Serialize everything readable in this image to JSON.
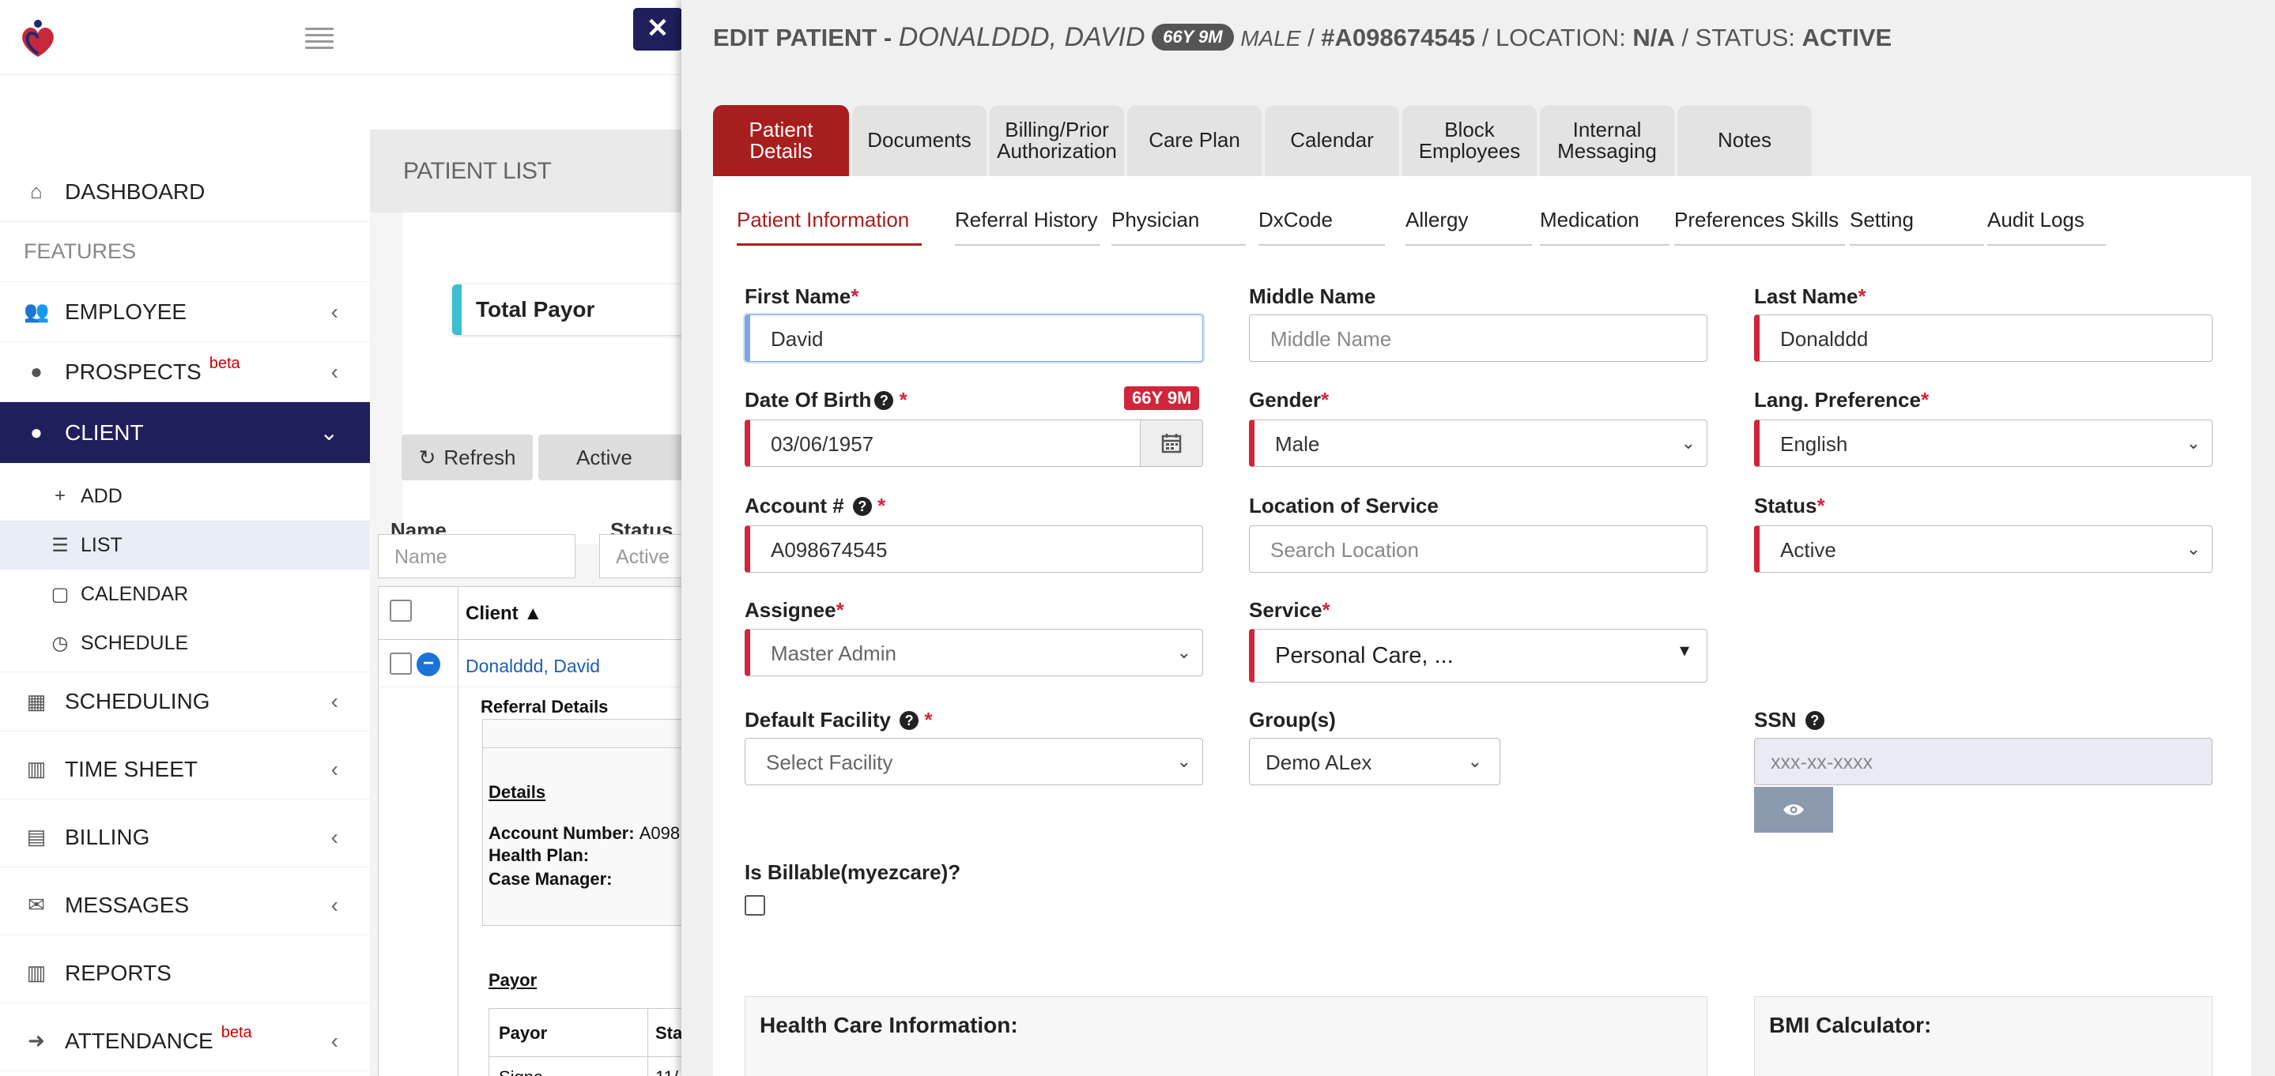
{
  "sidebar": {
    "dashboard": "DASHBOARD",
    "features": "FEATURES",
    "employee": "EMPLOYEE",
    "prospects": "PROSPECTS",
    "prospects_badge": "beta",
    "client": "CLIENT",
    "client_sub": [
      "ADD",
      "LIST",
      "CALENDAR",
      "SCHEDULE"
    ],
    "scheduling": "SCHEDULING",
    "time_sheet": "TIME SHEET",
    "billing": "BILLING",
    "messages": "MESSAGES",
    "reports": "REPORTS",
    "attendance": "ATTENDANCE",
    "attendance_badge": "beta"
  },
  "patient_list": {
    "title": "PATIENT LIST",
    "total_payor": "Total Payor",
    "refresh_label": "Refresh",
    "active_filter": "Active",
    "name_label": "Name",
    "name_placeholder": "Name",
    "status_label": "Status",
    "status_value": "Active",
    "col_client": "Client",
    "row_client": "Donalddd, David",
    "referral_details": "Referral Details",
    "details": "Details",
    "account_number_label": "Account Number:",
    "account_number_value": "A098",
    "health_plan_label": "Health Plan:",
    "case_manager_label": "Case Manager:",
    "payor_heading": "Payor",
    "payor_col": "Payor",
    "status_col_partial": "Sta",
    "row_partial_1": "Signa",
    "row_partial_2": "11/"
  },
  "modal": {
    "title_prefix": "EDIT PATIENT - ",
    "patient_name": "DONALDDD, DAVID",
    "age": "66Y 9M",
    "gender": "MALE",
    "account": "#A098674545",
    "location_label": "LOCATION:",
    "location_value": "N/A",
    "status_label": "STATUS:",
    "status_value": "ACTIVE",
    "tabs": [
      "Patient Details",
      "Documents",
      "Billing/Prior Authorization",
      "Care Plan",
      "Calendar",
      "Block Employees",
      "Internal Messaging",
      "Notes"
    ],
    "subtabs": [
      "Patient Information",
      "Referral History",
      "Physician",
      "DxCode",
      "Allergy",
      "Medication",
      "Preferences Skills",
      "Setting",
      "Audit Logs"
    ]
  },
  "form": {
    "first_name_label": "First Name",
    "first_name_value": "David",
    "middle_name_label": "Middle Name",
    "middle_name_placeholder": "Middle Name",
    "last_name_label": "Last Name",
    "last_name_value": "Donalddd",
    "dob_label": "Date Of Birth",
    "dob_value": "03/06/1957",
    "age_badge": "66Y 9M",
    "gender_label": "Gender",
    "gender_value": "Male",
    "lang_label": "Lang. Preference",
    "lang_value": "English",
    "account_label": "Account #",
    "account_value": "A098674545",
    "location_label": "Location of Service",
    "location_placeholder": "Search Location",
    "status_label": "Status",
    "status_value": "Active",
    "assignee_label": "Assignee",
    "assignee_value": "Master Admin",
    "service_label": "Service",
    "service_value": "Personal Care, ...",
    "facility_label": "Default Facility",
    "facility_value": "Select Facility",
    "groups_label": "Group(s)",
    "groups_value": "Demo ALex",
    "ssn_label": "SSN",
    "ssn_placeholder": "xxx-xx-xxxx",
    "billable_label": "Is Billable(myezcare)?",
    "health_care_heading": "Health Care Information:",
    "bmi_heading": "BMI Calculator:"
  },
  "colors": {
    "brand_navy": "#1f1f5c",
    "accent_red": "#a81d1d",
    "required_red": "#d0253a"
  },
  "icons": [
    "home-icon",
    "users-icon",
    "user-icon",
    "plus-icon",
    "list-icon",
    "calendar-icon",
    "clock-icon",
    "bar-chart-icon",
    "file-icon",
    "envelope-icon",
    "sign-in-icon",
    "refresh-icon",
    "eye-icon",
    "question-icon",
    "chevron-down-icon",
    "chevron-left-icon",
    "close-icon",
    "hamburger-icon"
  ]
}
